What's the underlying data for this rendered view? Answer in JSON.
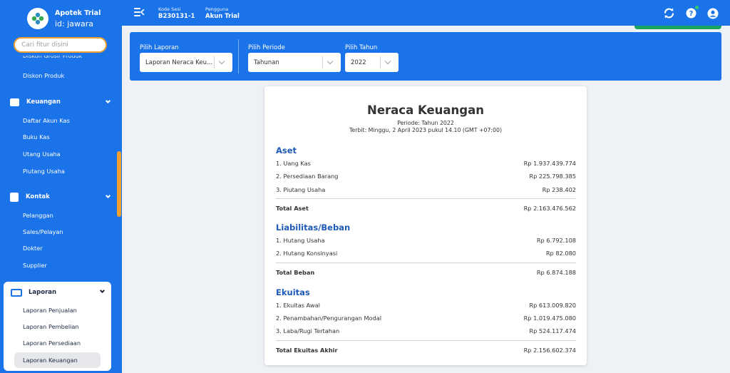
{
  "app": {
    "name": "Apotek Trial",
    "user_id": "id: jawara",
    "search_placeholder": "Cari fitur disini"
  },
  "sidebar": {
    "cut_item": "Diskon Grosir Produk",
    "discount_item": "Diskon Produk",
    "groups": [
      {
        "label": "Keuangan",
        "items": [
          "Daftar Akun Kas",
          "Buku Kas",
          "Utang Usaha",
          "Piutang Usaha"
        ]
      },
      {
        "label": "Kontak",
        "items": [
          "Pelanggan",
          "Sales/Pelayan",
          "Dokter",
          "Supplier"
        ]
      },
      {
        "label": "Laporan",
        "items": [
          "Laporan Penjualan",
          "Laporan Pembelian",
          "Laporan Persediaan",
          "Laporan Keuangan"
        ],
        "active": "Laporan Keuangan"
      }
    ]
  },
  "topbar": {
    "session_label": "Kode Sesi",
    "session_value": "B230131-1",
    "user_label": "Pengguna",
    "user_value": "Akun Trial",
    "icons": [
      "sync-icon",
      "help-icon",
      "account-icon"
    ]
  },
  "filters": {
    "report_label": "Pilih Laporan",
    "report_value": "Laporan Neraca Keu...",
    "period_label": "Pilih Periode",
    "period_value": "Tahunan",
    "year_label": "Pilih Tahun",
    "year_value": "2022"
  },
  "report": {
    "title": "Neraca Keuangan",
    "period": "Periode: Tahun 2022",
    "published": "Terbit: Minggu, 2 April 2023 pukul 14.10 (GMT +07:00)",
    "sections": [
      {
        "title": "Aset",
        "rows": [
          {
            "label": "1. Uang Kas",
            "value": "Rp 1.937.439.774"
          },
          {
            "label": "2. Persediaan Barang",
            "value": "Rp 225.798.385"
          },
          {
            "label": "3. Piutang Usaha",
            "value": "Rp 238.402"
          }
        ],
        "total_label": "Total Aset",
        "total_value": "Rp 2.163.476.562"
      },
      {
        "title": "Liabilitas/Beban",
        "rows": [
          {
            "label": "1. Hutang Usaha",
            "value": "Rp 6.792.108"
          },
          {
            "label": "2. Hutang Konsinyasi",
            "value": "Rp 82.080"
          }
        ],
        "total_label": "Total Beban",
        "total_value": "Rp 6.874.188"
      },
      {
        "title": "Ekuitas",
        "rows": [
          {
            "label": "1. Ekuitas Awal",
            "value": "Rp 613.009.820"
          },
          {
            "label": "2. Penambahan/Pengurangan Modal",
            "value": "Rp 1.019.475.080"
          },
          {
            "label": "3. Laba/Rugi Tertahan",
            "value": "Rp 524.117.474"
          }
        ],
        "total_label": "Total Ekuitas Akhir",
        "total_value": "Rp 2.156.602.374"
      }
    ]
  },
  "colors": {
    "primary": "#1a73e8",
    "accent": "#f0a030",
    "section_title": "#1e5bb8",
    "success": "#1aa260"
  }
}
